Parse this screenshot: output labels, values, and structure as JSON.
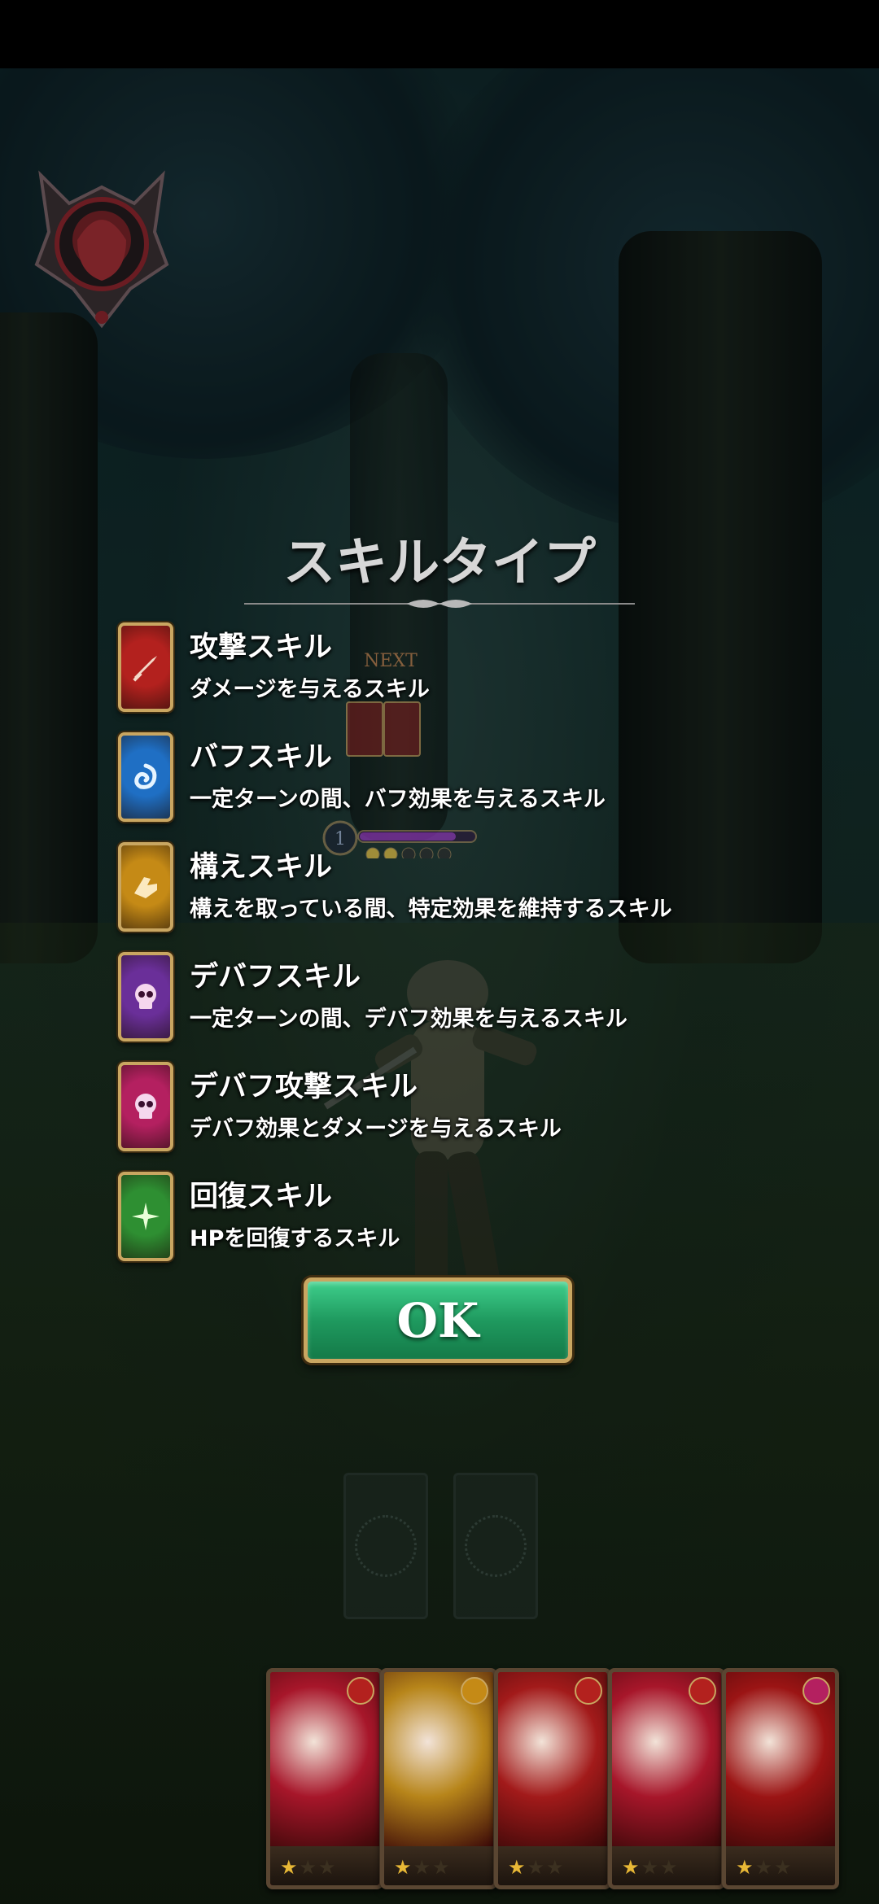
{
  "screen": {
    "title": "スキルタイプ",
    "next_label": "NEXT",
    "gauge_level": "1",
    "gauge_dots_filled": 2,
    "gauge_dots_total": 5
  },
  "skills": [
    {
      "name": "攻撃スキル",
      "desc": "ダメージを与えるスキル",
      "color": "#b3211e",
      "icon": "sword-icon"
    },
    {
      "name": "バフスキル",
      "desc": "一定ターンの間、バフ効果を与えるスキル",
      "color": "#1f6fc4",
      "icon": "buff-swirl-icon"
    },
    {
      "name": "構えスキル",
      "desc": "構えを取っている間、特定効果を維持するスキル",
      "color": "#c58a16",
      "icon": "stance-hand-icon"
    },
    {
      "name": "デバフスキル",
      "desc": "一定ターンの間、デバフ効果を与えるスキル",
      "color": "#6a2f99",
      "icon": "skull-icon"
    },
    {
      "name": "デバフ攻撃スキル",
      "desc": "デバフ効果とダメージを与えるスキル",
      "color": "#b42060",
      "icon": "skull-icon"
    },
    {
      "name": "回復スキル",
      "desc": "HPを回復するスキル",
      "color": "#2e8f32",
      "icon": "sparkle-icon"
    }
  ],
  "ok_button": {
    "label": "OK"
  },
  "hand_cards": [
    {
      "type": "attack",
      "badge_color": "#b3211e",
      "stars_filled": 1,
      "stars_total": 3,
      "art": "#a7162a"
    },
    {
      "type": "stance",
      "badge_color": "#c58a16",
      "stars_filled": 1,
      "stars_total": 3,
      "art": "#b7851a"
    },
    {
      "type": "attack",
      "badge_color": "#b3211e",
      "stars_filled": 1,
      "stars_total": 3,
      "art": "#a21a1a"
    },
    {
      "type": "attack",
      "badge_color": "#b3211e",
      "stars_filled": 1,
      "stars_total": 3,
      "art": "#a7162a"
    },
    {
      "type": "debuff-attack",
      "badge_color": "#b42060",
      "stars_filled": 1,
      "stars_total": 3,
      "art": "#9b1414"
    }
  ]
}
